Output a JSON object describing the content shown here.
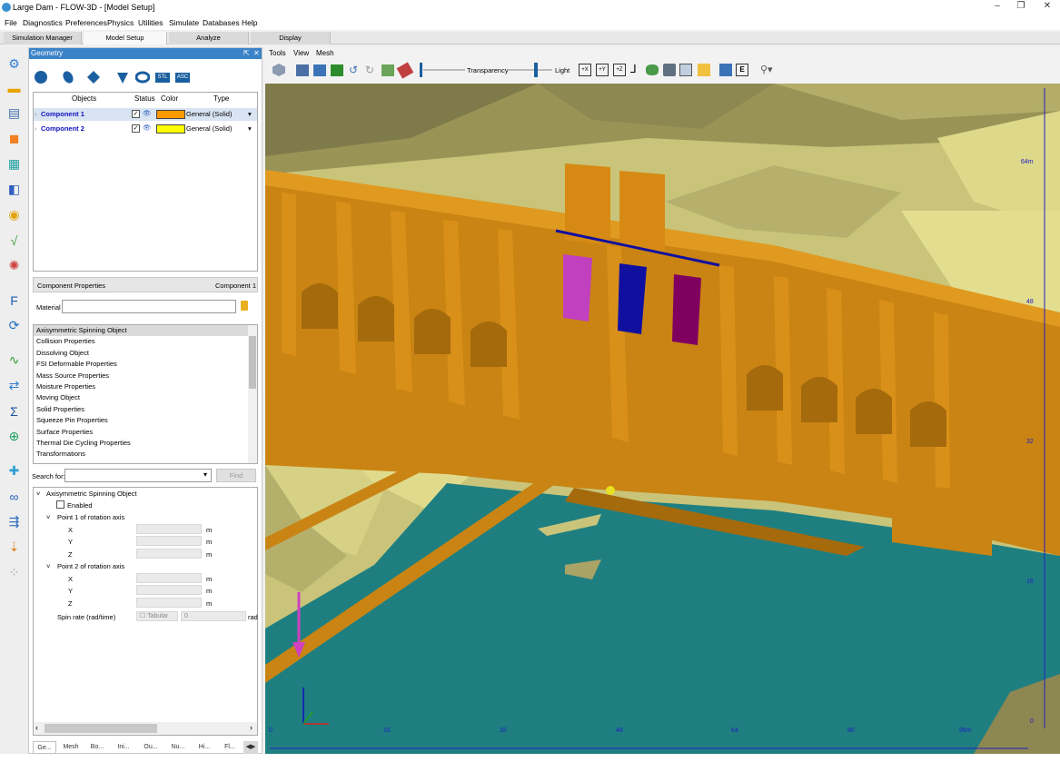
{
  "window": {
    "title": "Large Dam - FLOW-3D - [Model Setup]",
    "controls": [
      "–",
      "❐",
      "✕"
    ]
  },
  "menubar": [
    "File",
    "Diagnostics",
    "Preferences",
    "Physics",
    "Utilities",
    "Simulate",
    "Databases",
    "Help"
  ],
  "main_tabs": [
    "Simulation Manager",
    "Model Setup",
    "Analyze",
    "Display"
  ],
  "active_main_tab": "Model Setup",
  "geometry_panel": {
    "title": "Geometry",
    "header_controls": [
      "⇱",
      "✕"
    ],
    "toolbar_labels": [
      "STL",
      "ASC"
    ],
    "columns": [
      "Objects",
      "Status",
      "Color",
      "Type"
    ],
    "components": [
      {
        "name": "Component 1",
        "type": "General (Solid)",
        "color": "#ff9900"
      },
      {
        "name": "Component 2",
        "type": "General (Solid)",
        "color": "#ffff00"
      }
    ],
    "component_properties_label": "Component Properties",
    "selected_component": "Component 1",
    "material_label": "Material",
    "material_value": "",
    "property_list": [
      "Axisymmetric Spinning Object",
      "Collision Properties",
      "Dissolving Object",
      "FSI Deformable Properties",
      "Mass Source Properties",
      "Moisture Properties",
      "Moving Object",
      "Solid Properties",
      "Squeeze Pin Properties",
      "Surface Properties",
      "Thermal Die Cycling Properties",
      "Transformations"
    ],
    "search_label": "Search for:",
    "search_value": "",
    "find_button": "Find",
    "tree": {
      "root": "Axisymmetric Spinning Object",
      "enabled_label": "Enabled",
      "point1_label": "Point 1 of rotation axis",
      "point2_label": "Point 2 of rotation axis",
      "axes": [
        "X",
        "Y",
        "Z"
      ],
      "unit": "m",
      "spin_label": "Spin rate (rad/time)",
      "tabular_label": "Tabular",
      "spin_value": "0",
      "spin_unit": "rad"
    },
    "bottom_tabs": [
      "Ge...",
      "Mesh",
      "Bo...",
      "Ini...",
      "Ou...",
      "Nu...",
      "Hi...",
      "Fl..."
    ]
  },
  "viewport": {
    "menu": [
      "Tools",
      "View",
      "Mesh"
    ],
    "transparency_label": "Transparency",
    "light_label": "Light",
    "toolbar_icon_labels": [
      "+X",
      "+Y",
      "+Z",
      "E"
    ],
    "y_axis_ticks": [
      "64m",
      "48",
      "32",
      "16",
      "0"
    ],
    "x_axis_ticks": [
      "0",
      "16",
      "32",
      "48",
      "64",
      "80",
      "96m"
    ],
    "colors": {
      "terrain": "#c9c47a",
      "dam": "#d08a10",
      "water": "#1f7f80",
      "gate_magenta": "#c040c0",
      "gate_blue": "#1010a0",
      "gate_purple": "#800060"
    }
  }
}
